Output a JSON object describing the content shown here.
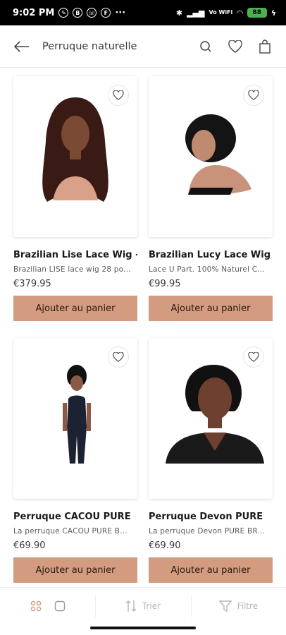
{
  "status_bar": {
    "time": "9:02 PM",
    "dots": "···",
    "network": "Vo WiFi",
    "battery": "88"
  },
  "header": {
    "title": "Perruque naturelle"
  },
  "colors": {
    "accent": "#d39b7f",
    "text": "#1a1a1a"
  },
  "products": [
    {
      "name": "Brazilian Lise Lace Wig -",
      "desc": "Brazilian LISE lace wig 28 po...",
      "price": "€379.95",
      "button": "Ajouter au panier"
    },
    {
      "name": "Brazilian Lucy Lace Wig",
      "desc": "Lace U Part. 100% Naturel C...",
      "price": "€99.95",
      "button": "Ajouter au panier"
    },
    {
      "name": "Perruque CACOU PURE",
      "desc": "La perruque CACOU PURE B...",
      "price": "€69.90",
      "button": "Ajouter au panier"
    },
    {
      "name": "Perruque Devon PURE",
      "desc": "La perruque Devon PURE BR...",
      "price": "€69.90",
      "button": "Ajouter au panier"
    }
  ],
  "bottom_bar": {
    "sort_label": "Trier",
    "filter_label": "Filtre"
  }
}
